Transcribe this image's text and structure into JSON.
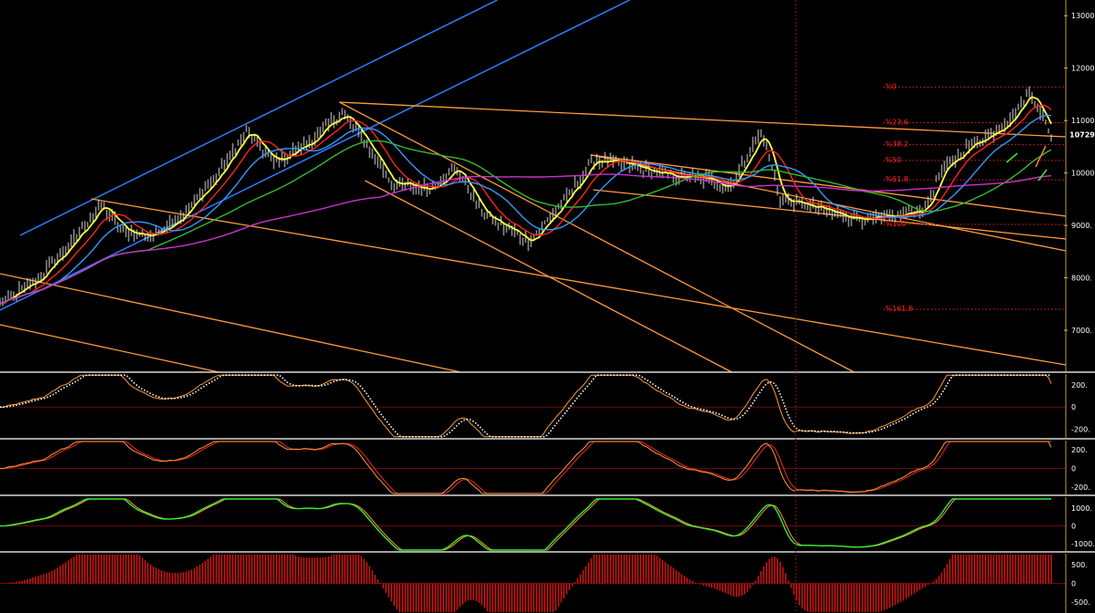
{
  "chart_data": [
    {
      "type": "candlestick",
      "panel": "price",
      "ylim": [
        6200,
        13300
      ],
      "yticks": [
        "13000.",
        "12000.",
        "11000.",
        "10000.",
        "9000.",
        "8000.",
        "7000."
      ],
      "last_price_label": "10729.4",
      "fibonacci_labels": [
        "%0",
        "%23.6",
        "%38.2",
        "%50",
        "%61.8",
        "%100",
        "%161.8"
      ],
      "fibonacci_levels": [
        11640,
        10960,
        10540,
        10240,
        9870,
        9020,
        7400
      ],
      "price_path": [
        [
          0,
          7500
        ],
        [
          40,
          7950
        ],
        [
          80,
          8700
        ],
        [
          110,
          9400
        ],
        [
          135,
          8900
        ],
        [
          165,
          8800
        ],
        [
          200,
          9200
        ],
        [
          240,
          10000
        ],
        [
          270,
          10800
        ],
        [
          300,
          10200
        ],
        [
          340,
          10600
        ],
        [
          375,
          11150
        ],
        [
          400,
          10600
        ],
        [
          430,
          9800
        ],
        [
          470,
          9700
        ],
        [
          500,
          10100
        ],
        [
          530,
          9200
        ],
        [
          580,
          8700
        ],
        [
          620,
          9500
        ],
        [
          650,
          10250
        ],
        [
          690,
          10150
        ],
        [
          730,
          9950
        ],
        [
          770,
          9900
        ],
        [
          800,
          9750
        ],
        [
          835,
          10800
        ],
        [
          855,
          9500
        ],
        [
          880,
          9400
        ],
        [
          920,
          9200
        ],
        [
          960,
          9100
        ],
        [
          990,
          9200
        ],
        [
          1015,
          9350
        ],
        [
          1030,
          10000
        ],
        [
          1060,
          10500
        ],
        [
          1090,
          10800
        ],
        [
          1110,
          11100
        ],
        [
          1128,
          11550
        ],
        [
          1140,
          11200
        ],
        [
          1150,
          10729
        ]
      ],
      "moving_averages": [
        {
          "color": "#ffff44",
          "period_hint": "short"
        },
        {
          "color": "#ff2222",
          "period_hint": "medium"
        },
        {
          "color": "#3399ff",
          "period_hint": "medium-long"
        },
        {
          "color": "#33bb33",
          "period_hint": "long"
        },
        {
          "color": "#cc33cc",
          "period_hint": "very long"
        }
      ]
    },
    {
      "type": "line",
      "panel": "oscillator-1",
      "ylim": [
        -280,
        300
      ],
      "yticks": [
        "200.",
        "0",
        "-200."
      ],
      "series_colors": [
        "#ff9933",
        "#ffffff"
      ]
    },
    {
      "type": "line",
      "panel": "oscillator-2",
      "ylim": [
        -280,
        300
      ],
      "yticks": [
        "200.",
        "0",
        "-200."
      ],
      "series_colors": [
        "#ff9933",
        "#cc2222"
      ]
    },
    {
      "type": "line",
      "panel": "oscillator-3",
      "ylim": [
        -1400,
        1600
      ],
      "yticks": [
        "1000.",
        "0",
        "-1000."
      ],
      "series_colors": [
        "#33ee33",
        "#ff9933"
      ]
    },
    {
      "type": "bar",
      "panel": "histogram",
      "ylim": [
        -800,
        800
      ],
      "yticks": [
        "500.",
        "0",
        "-500."
      ],
      "bar_color": "#cc1111"
    }
  ]
}
